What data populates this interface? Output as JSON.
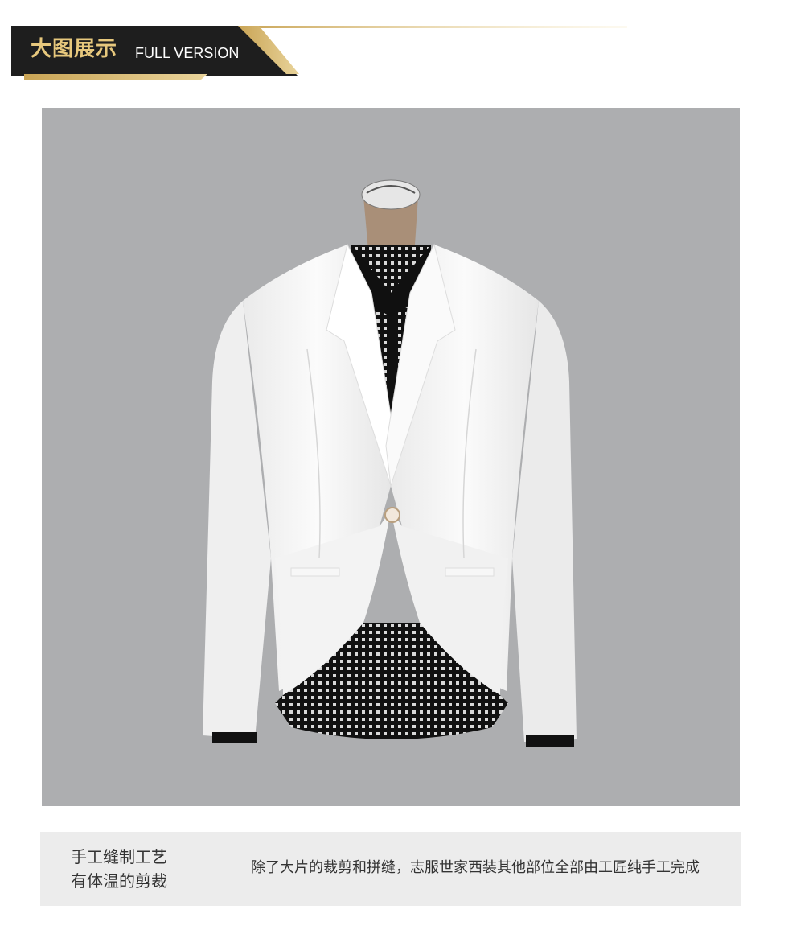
{
  "header": {
    "title_cn": "大图展示",
    "title_en": "FULL VERSION",
    "colors": {
      "dark": "#1e1e1e",
      "gold": "#d4b56a",
      "title": "#e7c87d"
    }
  },
  "photo": {
    "description_icon": "jacket-image",
    "background": "#adaeb0"
  },
  "caption": {
    "feature_line1": "手工缝制工艺",
    "feature_line2": "有体温的剪裁",
    "description": "除了大片的裁剪和拼缝，志服世家西装其他部位全部由工匠纯手工完成"
  }
}
